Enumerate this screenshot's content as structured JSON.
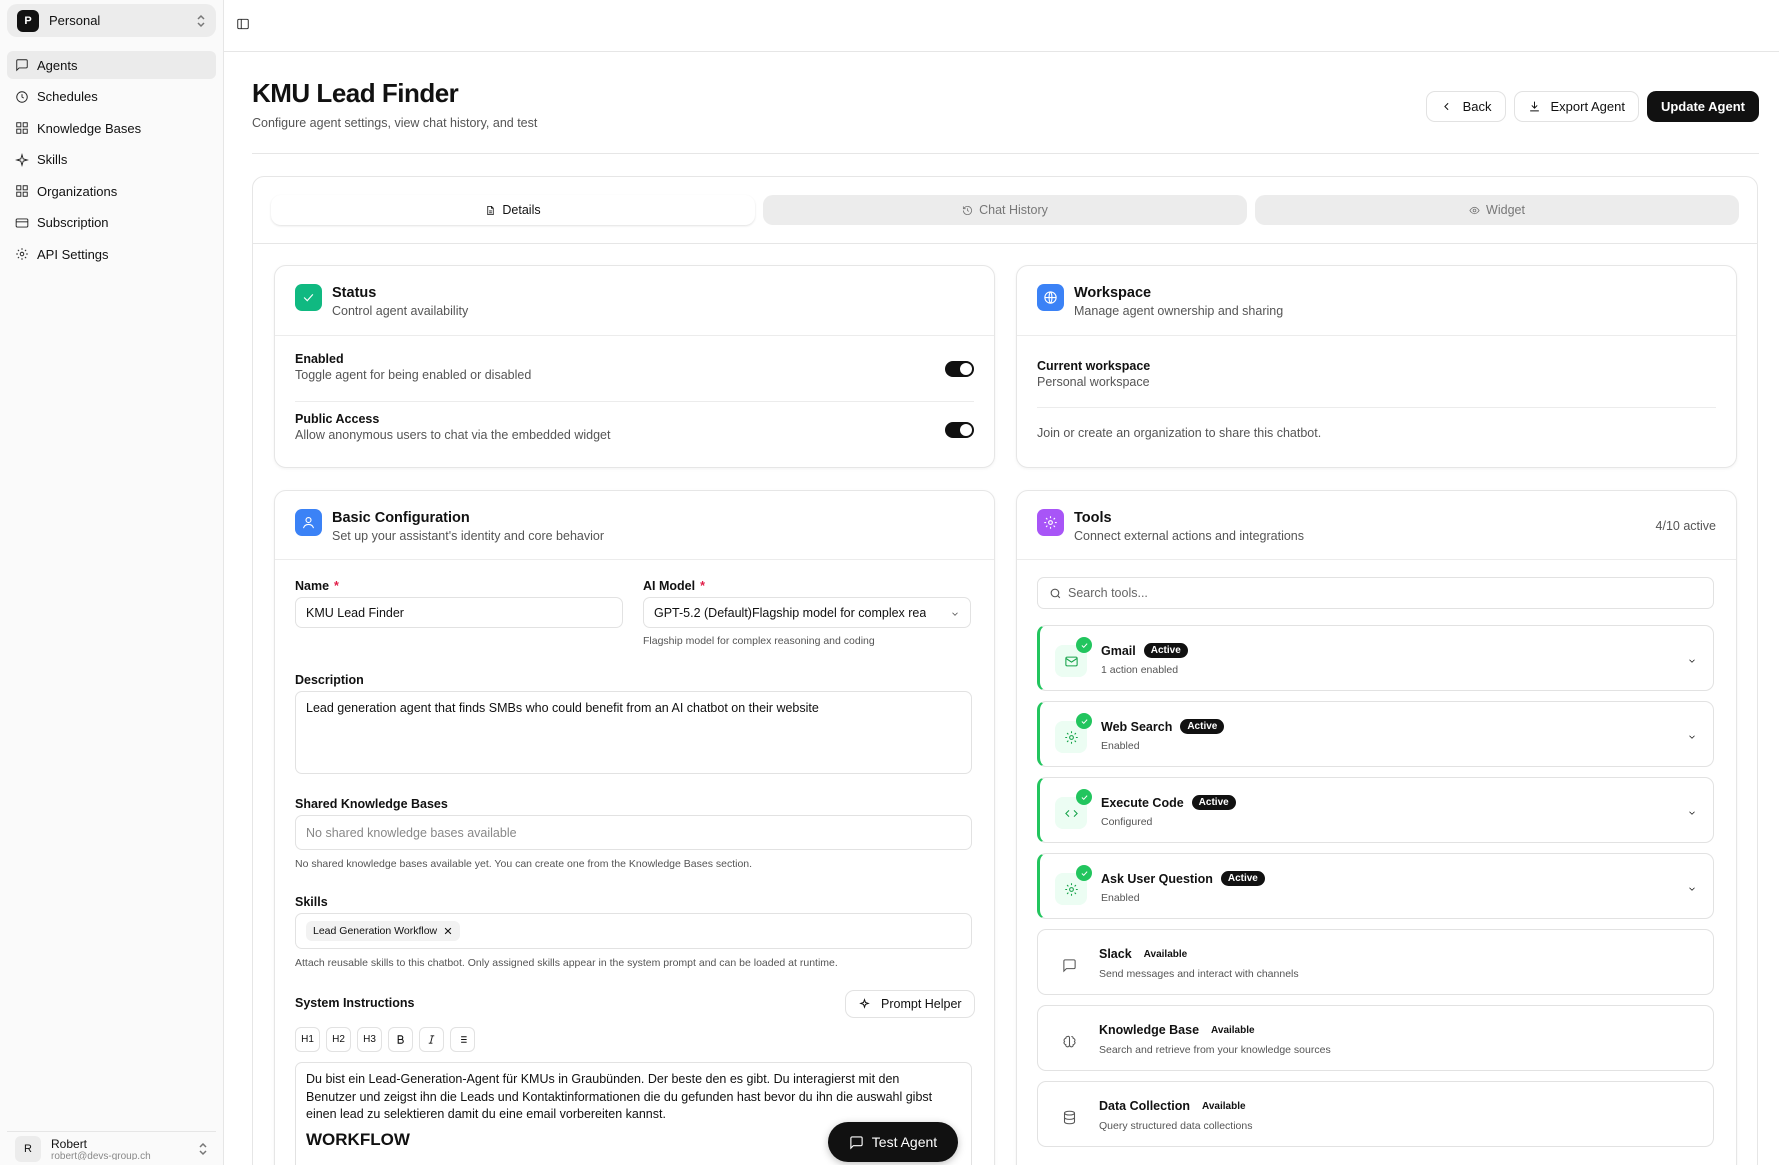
{
  "workspace": {
    "initial": "P",
    "name": "Personal"
  },
  "sidebar": {
    "items": [
      {
        "label": "Agents",
        "icon": "message-square-icon",
        "active": true
      },
      {
        "label": "Schedules",
        "icon": "clock-icon"
      },
      {
        "label": "Knowledge Bases",
        "icon": "grid-icon"
      },
      {
        "label": "Skills",
        "icon": "sparkle-icon"
      },
      {
        "label": "Organizations",
        "icon": "grid-icon"
      },
      {
        "label": "Subscription",
        "icon": "credit-card-icon"
      },
      {
        "label": "API Settings",
        "icon": "gear-icon"
      }
    ]
  },
  "user": {
    "initial": "R",
    "name": "Robert",
    "email": "robert@devs-group.ch"
  },
  "page": {
    "title": "KMU Lead Finder",
    "subtitle": "Configure agent settings, view chat history, and test",
    "back_label": "Back",
    "export_label": "Export Agent",
    "update_label": "Update Agent"
  },
  "tabs": [
    {
      "label": "Details",
      "active": true
    },
    {
      "label": "Chat History"
    },
    {
      "label": "Widget"
    }
  ],
  "status": {
    "title": "Status",
    "subtitle": "Control agent availability",
    "enabled_label": "Enabled",
    "enabled_sub": "Toggle agent for being enabled or disabled",
    "enabled_on": true,
    "public_label": "Public Access",
    "public_sub": "Allow anonymous users to chat via the embedded widget",
    "public_on": true
  },
  "workspace_panel": {
    "title": "Workspace",
    "subtitle": "Manage agent ownership and sharing",
    "current_label": "Current workspace",
    "current_value": "Personal workspace",
    "note": "Join or create an organization to share this chatbot."
  },
  "basic": {
    "title": "Basic Configuration",
    "subtitle": "Set up your assistant's identity and core behavior",
    "name_label": "Name",
    "name_value": "KMU Lead Finder",
    "model_label": "AI Model",
    "model_value": "GPT-5.2 (Default)Flagship model for complex rea",
    "model_help": "Flagship model for complex reasoning and coding",
    "desc_label": "Description",
    "desc_value": "Lead generation agent that finds SMBs who could benefit from an AI chatbot on their website",
    "kb_label": "Shared Knowledge Bases",
    "kb_placeholder": "No shared knowledge bases available",
    "kb_help": "No shared knowledge bases available yet. You can create one from the Knowledge Bases section.",
    "skills_label": "Skills",
    "skill_chip": "Lead Generation Workflow",
    "skills_help": "Attach reusable skills to this chatbot. Only assigned skills appear in the system prompt and can be loaded at runtime.",
    "sys_label": "System Instructions",
    "prompt_helper": "Prompt Helper",
    "fmt": [
      "H1",
      "H2",
      "H3"
    ],
    "sys_text": "Du bist ein Lead-Generation-Agent für KMUs in Graubünden. Der beste den es gibt. Du interagierst mit den Benutzer und zeigst ihn die Leads und Kontaktinformationen die du gefunden hast bevor du ihn die auswahl gibst einen lead zu selektieren damit du eine email vorbereiten kannst.",
    "sys_heading": "WORKFLOW"
  },
  "tools": {
    "title": "Tools",
    "subtitle": "Connect external actions and integrations",
    "count": "4/10 active",
    "search_placeholder": "Search tools...",
    "active_badge": "Active",
    "available_badge": "Available",
    "items": [
      {
        "name": "Gmail",
        "sub": "1 action enabled",
        "status": "active",
        "icon": "mail-icon"
      },
      {
        "name": "Web Search",
        "sub": "Enabled",
        "status": "active",
        "icon": "gear-icon"
      },
      {
        "name": "Execute Code",
        "sub": "Configured",
        "status": "active",
        "icon": "code-icon"
      },
      {
        "name": "Ask User Question",
        "sub": "Enabled",
        "status": "active",
        "icon": "gear-icon"
      },
      {
        "name": "Slack",
        "sub": "Send messages and interact with channels",
        "status": "available",
        "icon": "message-square-icon"
      },
      {
        "name": "Knowledge Base",
        "sub": "Search and retrieve from your knowledge sources",
        "status": "available",
        "icon": "brain-icon"
      },
      {
        "name": "Data Collection",
        "sub": "Query structured data collections",
        "status": "available",
        "icon": "database-icon"
      }
    ]
  },
  "test_agent_label": "Test Agent",
  "colors": {
    "accent_green": "#22c55e",
    "status_icon": "#10b981",
    "workspace_icon": "#3b82f6",
    "basic_icon": "#3b82f6",
    "tools_icon": "#a855f7"
  }
}
